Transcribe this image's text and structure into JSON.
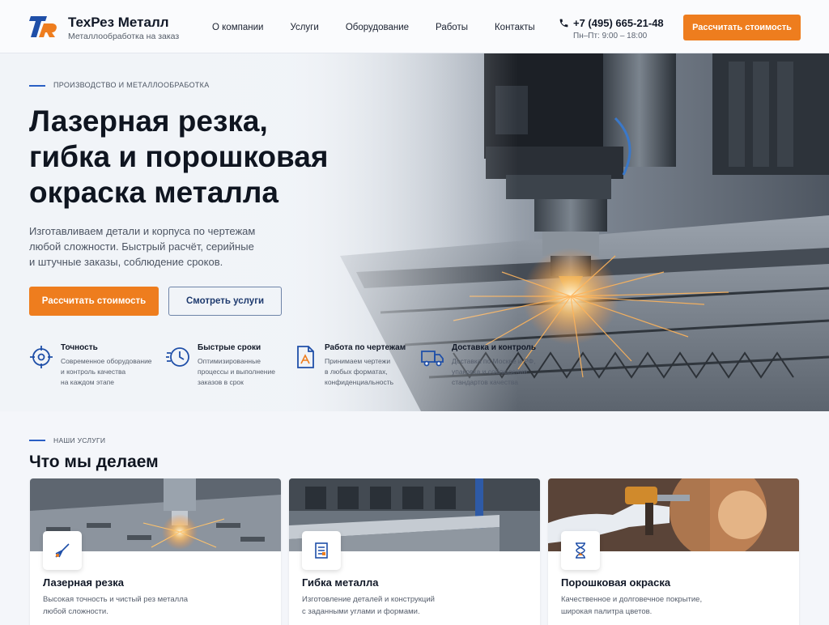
{
  "header": {
    "brand_name": "ТехРез Металл",
    "brand_sub": "Металлообработка на заказ",
    "nav": [
      "О компании",
      "Услуги",
      "Оборудование",
      "Работы",
      "Контакты"
    ],
    "phone": "+7 (495) 665-21-48",
    "hours": "Пн–Пт: 9:00 – 18:00",
    "cta": "Рассчитать стоимость"
  },
  "hero": {
    "eyebrow": "ПРОИЗВОДСТВО И МЕТАЛЛООБРАБОТКА",
    "title_line1": "Лазерная резка,",
    "title_line2": "гибка и порошковая",
    "title_line3": "окраска металла",
    "desc_line1": "Изготавливаем детали и корпуса по чертежам",
    "desc_line2": "любой сложности. Быстрый расчёт, серийные",
    "desc_line3": "и штучные заказы, соблюдение сроков.",
    "btn_primary": "Рассчитать стоимость",
    "btn_secondary": "Смотреть услуги",
    "features": [
      {
        "icon": "crosshair-icon",
        "title": "Точность",
        "lines": [
          "Современное оборудование",
          "и контроль качества",
          "на каждом этапе"
        ]
      },
      {
        "icon": "clock-speed-icon",
        "title": "Быстрые сроки",
        "lines": [
          "Оптимизированные",
          "процессы и выполнение",
          "заказов в срок"
        ]
      },
      {
        "icon": "drawing-document-icon",
        "title": "Работа по чертежам",
        "lines": [
          "Принимаем чертежи",
          "в любых форматах,",
          "конфиденциальность"
        ]
      },
      {
        "icon": "delivery-truck-icon",
        "title": "Доставка и контроль",
        "lines": [
          "Доставка по Москве и РФ,",
          "упаковка и соблюдение",
          "стандартов качества"
        ]
      }
    ]
  },
  "services": {
    "eyebrow": "НАШИ УСЛУГИ",
    "title": "Что мы делаем",
    "cards": [
      {
        "icon": "laser-icon",
        "title": "Лазерная резка",
        "lines": [
          "Высокая точность и чистый рез металла",
          "любой сложности."
        ]
      },
      {
        "icon": "blueprint-icon",
        "title": "Гибка металла",
        "lines": [
          "Изготовление деталей и конструкций",
          "с заданными углами и формами."
        ]
      },
      {
        "icon": "paint-icon",
        "title": "Порошковая окраска",
        "lines": [
          "Качественное и долговечное покрытие,",
          "широкая палитра цветов."
        ]
      }
    ]
  },
  "colors": {
    "accent": "#ee7d1e",
    "brand_blue": "#1f4fa8",
    "dark": "#0f1520"
  }
}
